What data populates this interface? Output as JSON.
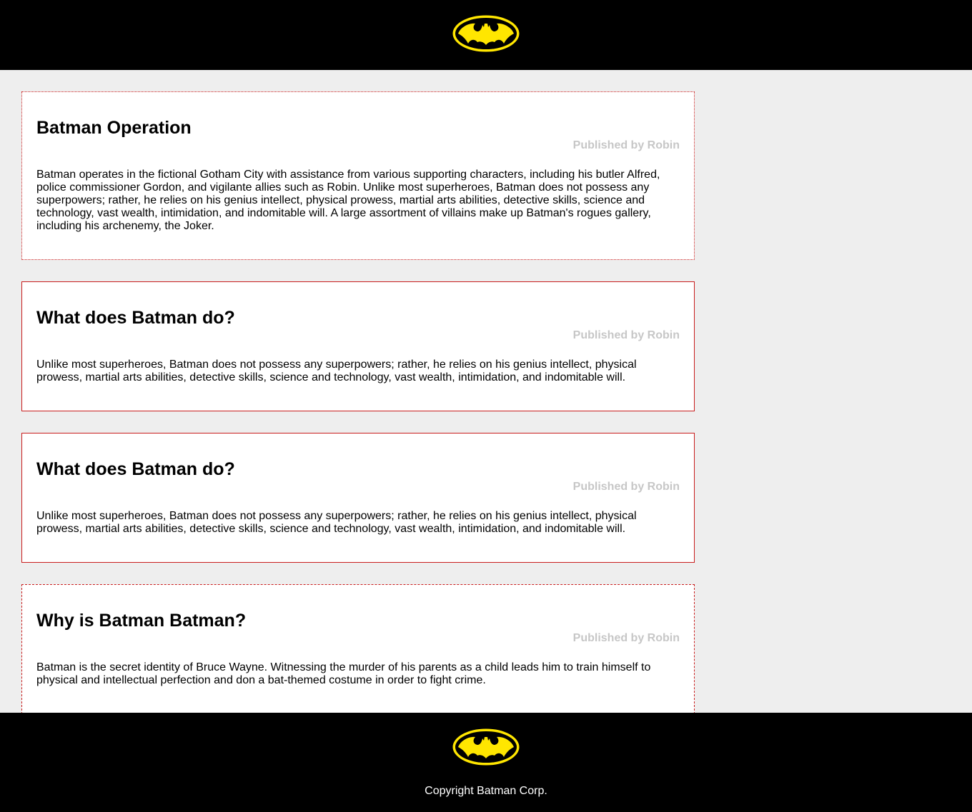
{
  "header": {
    "logo_icon": "batman-logo-icon"
  },
  "articles": [
    {
      "title": "Batman Operation",
      "author": "Published by Robin",
      "body": "Batman operates in the fictional Gotham City with assistance from various supporting characters, including his butler Alfred, police commissioner Gordon, and vigilante allies such as Robin. Unlike most superheroes, Batman does not possess any superpowers; rather, he relies on his genius intellect, physical prowess, martial arts abilities, detective skills, science and technology, vast wealth, intimidation, and indomitable will. A large assortment of villains make up Batman's rogues gallery, including his archenemy, the Joker."
    },
    {
      "title": "What does Batman do?",
      "author": "Published by Robin",
      "body": "Unlike most superheroes, Batman does not possess any superpowers; rather, he relies on his genius intellect, physical prowess, martial arts abilities, detective skills, science and technology, vast wealth, intimidation, and indomitable will."
    },
    {
      "title": "What does Batman do?",
      "author": "Published by Robin",
      "body": "Unlike most superheroes, Batman does not possess any superpowers; rather, he relies on his genius intellect, physical prowess, martial arts abilities, detective skills, science and technology, vast wealth, intimidation, and indomitable will."
    },
    {
      "title": "Why is Batman Batman?",
      "author": "Published by Robin",
      "body": "Batman is the secret identity of Bruce Wayne. Witnessing the murder of his parents as a child leads him to train himself to physical and intellectual perfection and don a bat-themed costume in order to fight crime."
    }
  ],
  "footer": {
    "logo_icon": "batman-logo-icon",
    "copyright": "Copyright Batman Corp."
  },
  "colors": {
    "header_bg": "#000000",
    "page_bg": "#eeeeee",
    "article_border": "#c81c1c",
    "author_text": "#c7c7c7",
    "logo_yellow": "#ffe600"
  }
}
